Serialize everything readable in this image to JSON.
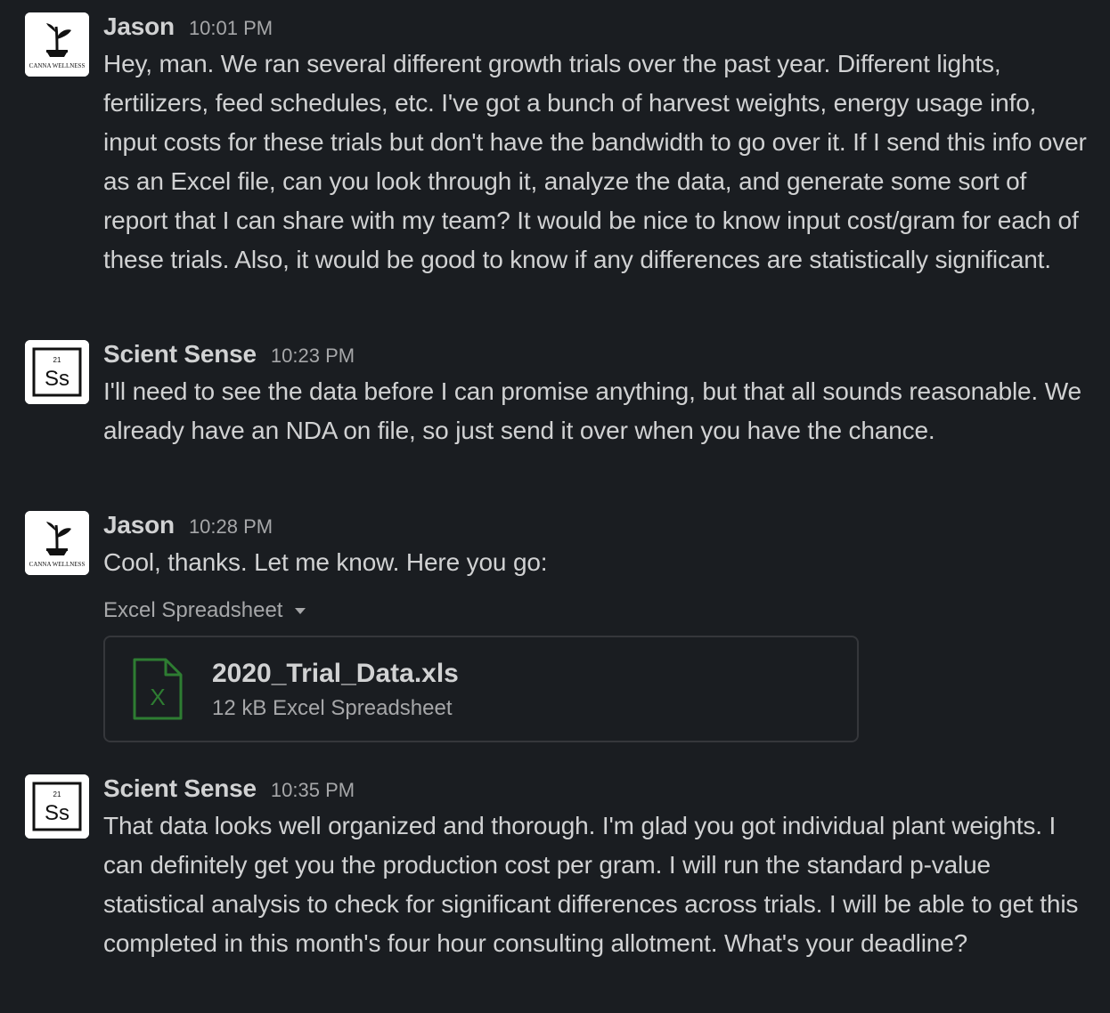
{
  "messages": [
    {
      "sender": "Jason",
      "time": "10:01 PM",
      "avatar_text": "CANNA WELLNESS",
      "text": "Hey, man. We ran several different growth trials over the past year. Different lights, fertilizers, feed schedules, etc. I've got a bunch of harvest weights, energy usage info, input costs for these trials but don't have the bandwidth to go over it. If I send this info over as an Excel file, can you look through it, analyze the data, and generate some sort of report that I can share with my team? It would be nice to know input cost/gram for each of these trials. Also, it would be good to know if any differences are statistically significant."
    },
    {
      "sender": "Scient Sense",
      "time": "10:23 PM",
      "avatar_number": "21",
      "avatar_symbol": "Ss",
      "text": "I'll need to see the data before I can promise anything, but that all sounds reasonable. We already have an NDA on file, so just send it over when you have the chance."
    },
    {
      "sender": "Jason",
      "time": "10:28 PM",
      "avatar_text": "CANNA WELLNESS",
      "text": "Cool, thanks. Let me know. Here you go:",
      "attachment": {
        "toggle_label": "Excel Spreadsheet",
        "file_name": "2020_Trial_Data.xls",
        "file_meta": "12 kB Excel Spreadsheet",
        "icon_letter": "X"
      }
    },
    {
      "sender": "Scient Sense",
      "time": "10:35 PM",
      "avatar_number": "21",
      "avatar_symbol": "Ss",
      "text": "That data looks well organized and thorough. I'm glad you got individual plant weights. I can definitely get you the production cost per gram. I will run the standard p-value statistical analysis to check for significant differences across trials. I will be able to get this completed in this month's four hour consulting allotment. What's your deadline?"
    }
  ],
  "colors": {
    "background": "#1a1d21",
    "text": "#d1d2d3",
    "muted": "#a6a7a9",
    "file_icon": "#2e7d32"
  }
}
